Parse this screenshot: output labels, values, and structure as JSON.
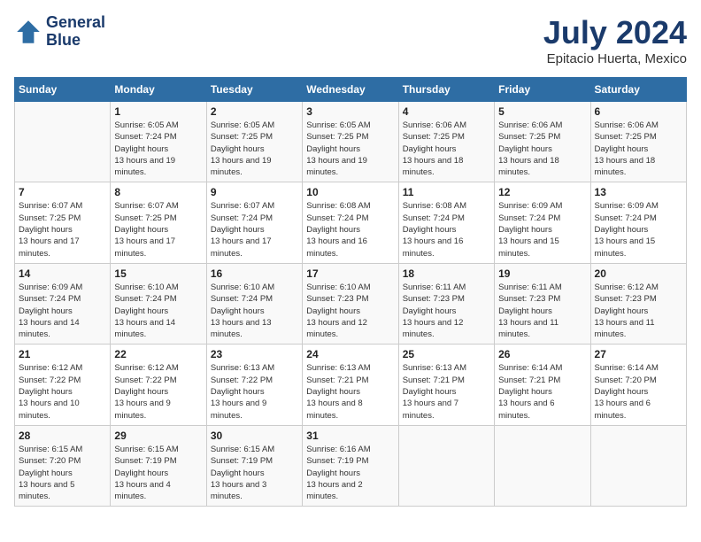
{
  "header": {
    "logo_line1": "General",
    "logo_line2": "Blue",
    "title": "July 2024",
    "subtitle": "Epitacio Huerta, Mexico"
  },
  "days_of_week": [
    "Sunday",
    "Monday",
    "Tuesday",
    "Wednesday",
    "Thursday",
    "Friday",
    "Saturday"
  ],
  "weeks": [
    [
      {
        "day": "",
        "sunrise": "",
        "sunset": "",
        "daylight": ""
      },
      {
        "day": "1",
        "sunrise": "6:05 AM",
        "sunset": "7:24 PM",
        "daylight": "13 hours and 19 minutes."
      },
      {
        "day": "2",
        "sunrise": "6:05 AM",
        "sunset": "7:25 PM",
        "daylight": "13 hours and 19 minutes."
      },
      {
        "day": "3",
        "sunrise": "6:05 AM",
        "sunset": "7:25 PM",
        "daylight": "13 hours and 19 minutes."
      },
      {
        "day": "4",
        "sunrise": "6:06 AM",
        "sunset": "7:25 PM",
        "daylight": "13 hours and 18 minutes."
      },
      {
        "day": "5",
        "sunrise": "6:06 AM",
        "sunset": "7:25 PM",
        "daylight": "13 hours and 18 minutes."
      },
      {
        "day": "6",
        "sunrise": "6:06 AM",
        "sunset": "7:25 PM",
        "daylight": "13 hours and 18 minutes."
      }
    ],
    [
      {
        "day": "7",
        "sunrise": "6:07 AM",
        "sunset": "7:25 PM",
        "daylight": "13 hours and 17 minutes."
      },
      {
        "day": "8",
        "sunrise": "6:07 AM",
        "sunset": "7:25 PM",
        "daylight": "13 hours and 17 minutes."
      },
      {
        "day": "9",
        "sunrise": "6:07 AM",
        "sunset": "7:24 PM",
        "daylight": "13 hours and 17 minutes."
      },
      {
        "day": "10",
        "sunrise": "6:08 AM",
        "sunset": "7:24 PM",
        "daylight": "13 hours and 16 minutes."
      },
      {
        "day": "11",
        "sunrise": "6:08 AM",
        "sunset": "7:24 PM",
        "daylight": "13 hours and 16 minutes."
      },
      {
        "day": "12",
        "sunrise": "6:09 AM",
        "sunset": "7:24 PM",
        "daylight": "13 hours and 15 minutes."
      },
      {
        "day": "13",
        "sunrise": "6:09 AM",
        "sunset": "7:24 PM",
        "daylight": "13 hours and 15 minutes."
      }
    ],
    [
      {
        "day": "14",
        "sunrise": "6:09 AM",
        "sunset": "7:24 PM",
        "daylight": "13 hours and 14 minutes."
      },
      {
        "day": "15",
        "sunrise": "6:10 AM",
        "sunset": "7:24 PM",
        "daylight": "13 hours and 14 minutes."
      },
      {
        "day": "16",
        "sunrise": "6:10 AM",
        "sunset": "7:24 PM",
        "daylight": "13 hours and 13 minutes."
      },
      {
        "day": "17",
        "sunrise": "6:10 AM",
        "sunset": "7:23 PM",
        "daylight": "13 hours and 12 minutes."
      },
      {
        "day": "18",
        "sunrise": "6:11 AM",
        "sunset": "7:23 PM",
        "daylight": "13 hours and 12 minutes."
      },
      {
        "day": "19",
        "sunrise": "6:11 AM",
        "sunset": "7:23 PM",
        "daylight": "13 hours and 11 minutes."
      },
      {
        "day": "20",
        "sunrise": "6:12 AM",
        "sunset": "7:23 PM",
        "daylight": "13 hours and 11 minutes."
      }
    ],
    [
      {
        "day": "21",
        "sunrise": "6:12 AM",
        "sunset": "7:22 PM",
        "daylight": "13 hours and 10 minutes."
      },
      {
        "day": "22",
        "sunrise": "6:12 AM",
        "sunset": "7:22 PM",
        "daylight": "13 hours and 9 minutes."
      },
      {
        "day": "23",
        "sunrise": "6:13 AM",
        "sunset": "7:22 PM",
        "daylight": "13 hours and 9 minutes."
      },
      {
        "day": "24",
        "sunrise": "6:13 AM",
        "sunset": "7:21 PM",
        "daylight": "13 hours and 8 minutes."
      },
      {
        "day": "25",
        "sunrise": "6:13 AM",
        "sunset": "7:21 PM",
        "daylight": "13 hours and 7 minutes."
      },
      {
        "day": "26",
        "sunrise": "6:14 AM",
        "sunset": "7:21 PM",
        "daylight": "13 hours and 6 minutes."
      },
      {
        "day": "27",
        "sunrise": "6:14 AM",
        "sunset": "7:20 PM",
        "daylight": "13 hours and 6 minutes."
      }
    ],
    [
      {
        "day": "28",
        "sunrise": "6:15 AM",
        "sunset": "7:20 PM",
        "daylight": "13 hours and 5 minutes."
      },
      {
        "day": "29",
        "sunrise": "6:15 AM",
        "sunset": "7:19 PM",
        "daylight": "13 hours and 4 minutes."
      },
      {
        "day": "30",
        "sunrise": "6:15 AM",
        "sunset": "7:19 PM",
        "daylight": "13 hours and 3 minutes."
      },
      {
        "day": "31",
        "sunrise": "6:16 AM",
        "sunset": "7:19 PM",
        "daylight": "13 hours and 2 minutes."
      },
      {
        "day": "",
        "sunrise": "",
        "sunset": "",
        "daylight": ""
      },
      {
        "day": "",
        "sunrise": "",
        "sunset": "",
        "daylight": ""
      },
      {
        "day": "",
        "sunrise": "",
        "sunset": "",
        "daylight": ""
      }
    ]
  ]
}
